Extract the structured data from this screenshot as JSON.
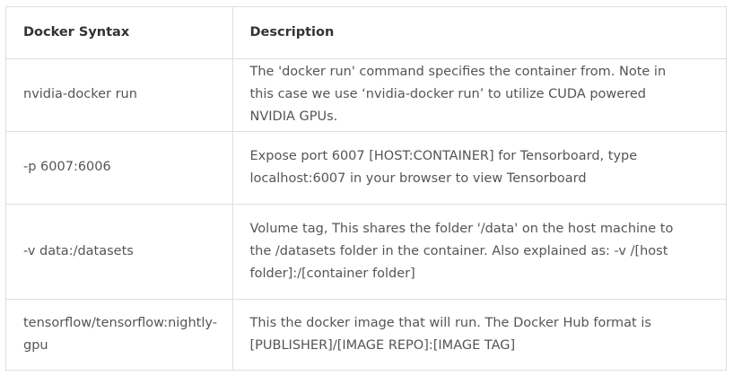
{
  "table": {
    "headers": [
      "Docker Syntax",
      "Description"
    ],
    "rows": [
      {
        "syntax": "nvidia-docker run",
        "description": "The 'docker run' command specifies the container from. Note in this case we use ‘nvidia-docker run’ to utilize CUDA powered NVIDIA GPUs."
      },
      {
        "syntax": "-p 6007:6006",
        "description": "Expose port 6007 [HOST:CONTAINER] for Tensorboard, type localhost:6007 in your browser to view Tensorboard"
      },
      {
        "syntax": "-v data:/datasets",
        "description": "Volume tag, This shares the folder '/data' on the host machine to the /datasets folder in the container. Also explained as: -v /[host folder]:/[container folder]"
      },
      {
        "syntax": "tensorflow/tensorflow:nightly-gpu",
        "description": "This the docker image that will run. The Docker Hub format is [PUBLISHER]/[IMAGE REPO]:[IMAGE TAG]"
      }
    ]
  }
}
